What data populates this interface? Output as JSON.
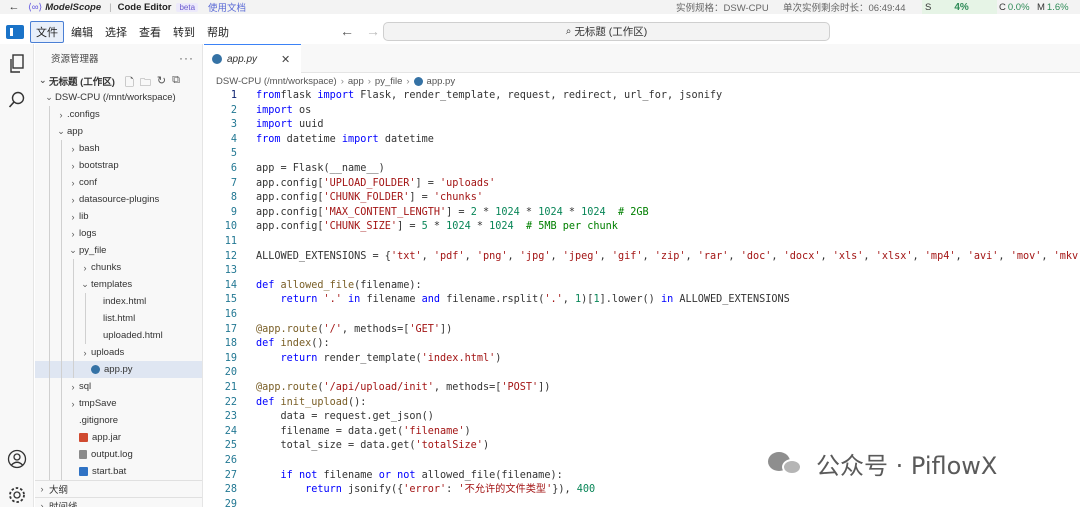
{
  "header": {
    "brand": "ModelScope",
    "product": "Code Editor",
    "badge": "beta",
    "docs_link": "使用文档",
    "spec": "实例规格：DSW-CPU",
    "remaining": "单次实例剩余时长：06:49:44",
    "stats": {
      "s_label": "S",
      "s_value": "4%",
      "c_label": "C",
      "c_value": "0.0%",
      "m_label": "M",
      "m_value": "1.6%"
    }
  },
  "menu": {
    "items": [
      "文件",
      "编辑",
      "选择",
      "查看",
      "转到",
      "帮助"
    ],
    "active": "文件",
    "command_center": "无标题 (工作区)"
  },
  "sidebar": {
    "title": "资源管理器",
    "workspace": "无标题 (工作区)",
    "tree": [
      {
        "label": "DSW-CPU (/mnt/workspace)",
        "depth": 0,
        "chev": "⌄",
        "type": "folder"
      },
      {
        "label": ".configs",
        "depth": 1,
        "chev": "›",
        "type": "folder"
      },
      {
        "label": "app",
        "depth": 1,
        "chev": "⌄",
        "type": "folder"
      },
      {
        "label": "bash",
        "depth": 2,
        "chev": "›",
        "type": "folder"
      },
      {
        "label": "bootstrap",
        "depth": 2,
        "chev": "›",
        "type": "folder"
      },
      {
        "label": "conf",
        "depth": 2,
        "chev": "›",
        "type": "folder"
      },
      {
        "label": "datasource-plugins",
        "depth": 2,
        "chev": "›",
        "type": "folder"
      },
      {
        "label": "lib",
        "depth": 2,
        "chev": "›",
        "type": "folder"
      },
      {
        "label": "logs",
        "depth": 2,
        "chev": "›",
        "type": "folder"
      },
      {
        "label": "py_file",
        "depth": 2,
        "chev": "⌄",
        "type": "folder"
      },
      {
        "label": "chunks",
        "depth": 3,
        "chev": "›",
        "type": "folder"
      },
      {
        "label": "templates",
        "depth": 3,
        "chev": "⌄",
        "type": "folder"
      },
      {
        "label": "index.html",
        "depth": 4,
        "chev": "",
        "type": "file"
      },
      {
        "label": "list.html",
        "depth": 4,
        "chev": "",
        "type": "file"
      },
      {
        "label": "uploaded.html",
        "depth": 4,
        "chev": "",
        "type": "file"
      },
      {
        "label": "uploads",
        "depth": 3,
        "chev": "›",
        "type": "folder"
      },
      {
        "label": "app.py",
        "depth": 3,
        "chev": "",
        "type": "py",
        "selected": true
      },
      {
        "label": "sql",
        "depth": 2,
        "chev": "›",
        "type": "folder"
      },
      {
        "label": "tmpSave",
        "depth": 2,
        "chev": "›",
        "type": "folder"
      },
      {
        "label": ".gitignore",
        "depth": 2,
        "chev": "",
        "type": "file"
      },
      {
        "label": "app.jar",
        "depth": 2,
        "chev": "",
        "type": "jar"
      },
      {
        "label": "output.log",
        "depth": 2,
        "chev": "",
        "type": "log"
      },
      {
        "label": "start.bat",
        "depth": 2,
        "chev": "",
        "type": "bat"
      }
    ],
    "outline": "大纲",
    "timeline": "时间线"
  },
  "editor": {
    "tab": "app.py",
    "breadcrumb": [
      "DSW-CPU (/mnt/workspace)",
      "app",
      "py_file",
      "app.py"
    ],
    "lines": [
      [
        [
          "kw",
          "from"
        ],
        [
          "",
          "flask"
        ],
        [
          "kw",
          " import"
        ],
        [
          "",
          " Flask, render_template, request, redirect, url_for, jsonify"
        ]
      ],
      [
        [
          "kw",
          "import"
        ],
        [
          "",
          " os"
        ]
      ],
      [
        [
          "kw",
          "import"
        ],
        [
          "",
          " uuid"
        ]
      ],
      [
        [
          "kw",
          "from"
        ],
        [
          "",
          " datetime "
        ],
        [
          "kw",
          "import"
        ],
        [
          "",
          " datetime"
        ]
      ],
      [],
      [
        [
          "",
          "app = Flask(__name__)"
        ]
      ],
      [
        [
          "",
          "app.config["
        ],
        [
          "str",
          "'UPLOAD_FOLDER'"
        ],
        [
          "",
          "] = "
        ],
        [
          "str",
          "'uploads'"
        ]
      ],
      [
        [
          "",
          "app.config["
        ],
        [
          "str",
          "'CHUNK_FOLDER'"
        ],
        [
          "",
          "] = "
        ],
        [
          "str",
          "'chunks'"
        ]
      ],
      [
        [
          "",
          "app.config["
        ],
        [
          "str",
          "'MAX_CONTENT_LENGTH'"
        ],
        [
          "",
          "] = "
        ],
        [
          "num",
          "2"
        ],
        [
          "",
          " * "
        ],
        [
          "num",
          "1024"
        ],
        [
          "",
          " * "
        ],
        [
          "num",
          "1024"
        ],
        [
          "",
          " * "
        ],
        [
          "num",
          "1024"
        ],
        [
          "cmt",
          "  # 2GB"
        ]
      ],
      [
        [
          "",
          "app.config["
        ],
        [
          "str",
          "'CHUNK_SIZE'"
        ],
        [
          "",
          "] = "
        ],
        [
          "num",
          "5"
        ],
        [
          "",
          " * "
        ],
        [
          "num",
          "1024"
        ],
        [
          "",
          " * "
        ],
        [
          "num",
          "1024"
        ],
        [
          "cmt",
          "  # 5MB per chunk"
        ]
      ],
      [],
      [
        [
          "",
          "ALLOWED_EXTENSIONS = {"
        ],
        [
          "str",
          "'txt'"
        ],
        [
          "",
          ", "
        ],
        [
          "str",
          "'pdf'"
        ],
        [
          "",
          ", "
        ],
        [
          "str",
          "'png'"
        ],
        [
          "",
          ", "
        ],
        [
          "str",
          "'jpg'"
        ],
        [
          "",
          ", "
        ],
        [
          "str",
          "'jpeg'"
        ],
        [
          "",
          ", "
        ],
        [
          "str",
          "'gif'"
        ],
        [
          "",
          ", "
        ],
        [
          "str",
          "'zip'"
        ],
        [
          "",
          ", "
        ],
        [
          "str",
          "'rar'"
        ],
        [
          "",
          ", "
        ],
        [
          "str",
          "'doc'"
        ],
        [
          "",
          ", "
        ],
        [
          "str",
          "'docx'"
        ],
        [
          "",
          ", "
        ],
        [
          "str",
          "'xls'"
        ],
        [
          "",
          ", "
        ],
        [
          "str",
          "'xlsx'"
        ],
        [
          "",
          ", "
        ],
        [
          "str",
          "'mp4'"
        ],
        [
          "",
          ", "
        ],
        [
          "str",
          "'avi'"
        ],
        [
          "",
          ", "
        ],
        [
          "str",
          "'mov'"
        ],
        [
          "",
          ", "
        ],
        [
          "str",
          "'mkv'"
        ],
        [
          "",
          ", "
        ],
        [
          "str",
          "'i"
        ]
      ],
      [],
      [
        [
          "kw",
          "def"
        ],
        [
          "fn",
          " allowed_file"
        ],
        [
          "",
          "(filename):"
        ]
      ],
      [
        [
          "",
          "    "
        ],
        [
          "kw",
          "return"
        ],
        [
          "",
          " "
        ],
        [
          "str",
          "'.'"
        ],
        [
          "kw",
          " in"
        ],
        [
          "",
          " filename "
        ],
        [
          "kw",
          "and"
        ],
        [
          "",
          " filename.rsplit("
        ],
        [
          "str",
          "'.'"
        ],
        [
          "",
          ", "
        ],
        [
          "num",
          "1"
        ],
        [
          "",
          ")["
        ],
        [
          "num",
          "1"
        ],
        [
          "",
          "].lower() "
        ],
        [
          "kw",
          "in"
        ],
        [
          "",
          " ALLOWED_EXTENSIONS"
        ]
      ],
      [],
      [
        [
          "deco",
          "@app.route"
        ],
        [
          "",
          "("
        ],
        [
          "str",
          "'/'"
        ],
        [
          "",
          ", methods=["
        ],
        [
          "str",
          "'GET'"
        ],
        [
          "",
          "])"
        ]
      ],
      [
        [
          "kw",
          "def"
        ],
        [
          "fn",
          " index"
        ],
        [
          "",
          "():"
        ]
      ],
      [
        [
          "",
          "    "
        ],
        [
          "kw",
          "return"
        ],
        [
          "",
          " render_template("
        ],
        [
          "str",
          "'index.html'"
        ],
        [
          "",
          ")"
        ]
      ],
      [],
      [
        [
          "deco",
          "@app.route"
        ],
        [
          "",
          "("
        ],
        [
          "str",
          "'/api/upload/init'"
        ],
        [
          "",
          ", methods=["
        ],
        [
          "str",
          "'POST'"
        ],
        [
          "",
          "])"
        ]
      ],
      [
        [
          "kw",
          "def"
        ],
        [
          "fn",
          " init_upload"
        ],
        [
          "",
          "():"
        ]
      ],
      [
        [
          "",
          "    data = request.get_json()"
        ]
      ],
      [
        [
          "",
          "    filename = data.get("
        ],
        [
          "str",
          "'filename'"
        ],
        [
          "",
          ")"
        ]
      ],
      [
        [
          "",
          "    total_size = data.get("
        ],
        [
          "str",
          "'totalSize'"
        ],
        [
          "",
          ")"
        ]
      ],
      [],
      [
        [
          "",
          "    "
        ],
        [
          "kw",
          "if not"
        ],
        [
          "",
          " filename "
        ],
        [
          "kw",
          "or not"
        ],
        [
          "",
          " allowed_file(filename):"
        ]
      ],
      [
        [
          "",
          "        "
        ],
        [
          "kw",
          "return"
        ],
        [
          "",
          " jsonify({"
        ],
        [
          "str",
          "'error'"
        ],
        [
          "",
          ": "
        ],
        [
          "str",
          "'不允许的文件类型'"
        ],
        [
          "",
          "}), "
        ],
        [
          "num",
          "400"
        ]
      ],
      []
    ]
  },
  "watermark": "公众号 · PiflowX"
}
